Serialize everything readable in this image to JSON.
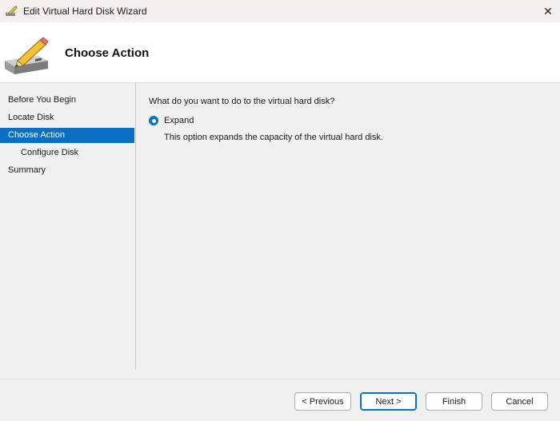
{
  "window": {
    "title": "Edit Virtual Hard Disk Wizard",
    "close_glyph": "✕"
  },
  "banner": {
    "heading": "Choose Action"
  },
  "sidebar": {
    "items": [
      {
        "label": "Before You Begin",
        "active": false
      },
      {
        "label": "Locate Disk",
        "active": false
      },
      {
        "label": "Choose Action",
        "active": true
      },
      {
        "label": "Configure Disk",
        "active": false
      },
      {
        "label": "Summary",
        "active": false
      }
    ]
  },
  "main": {
    "question": "What do you want to do to the virtual hard disk?",
    "option_label": "Expand",
    "option_selected": true,
    "option_description": "This option expands the capacity of the virtual hard disk."
  },
  "buttons": {
    "previous": "< Previous",
    "next": "Next >",
    "finish": "Finish",
    "cancel": "Cancel"
  },
  "colors": {
    "accent": "#0a6fc2",
    "titlebar": "#f5efef"
  },
  "icons": {
    "app": "disk-pencil-icon",
    "banner": "disk-pencil-icon"
  }
}
